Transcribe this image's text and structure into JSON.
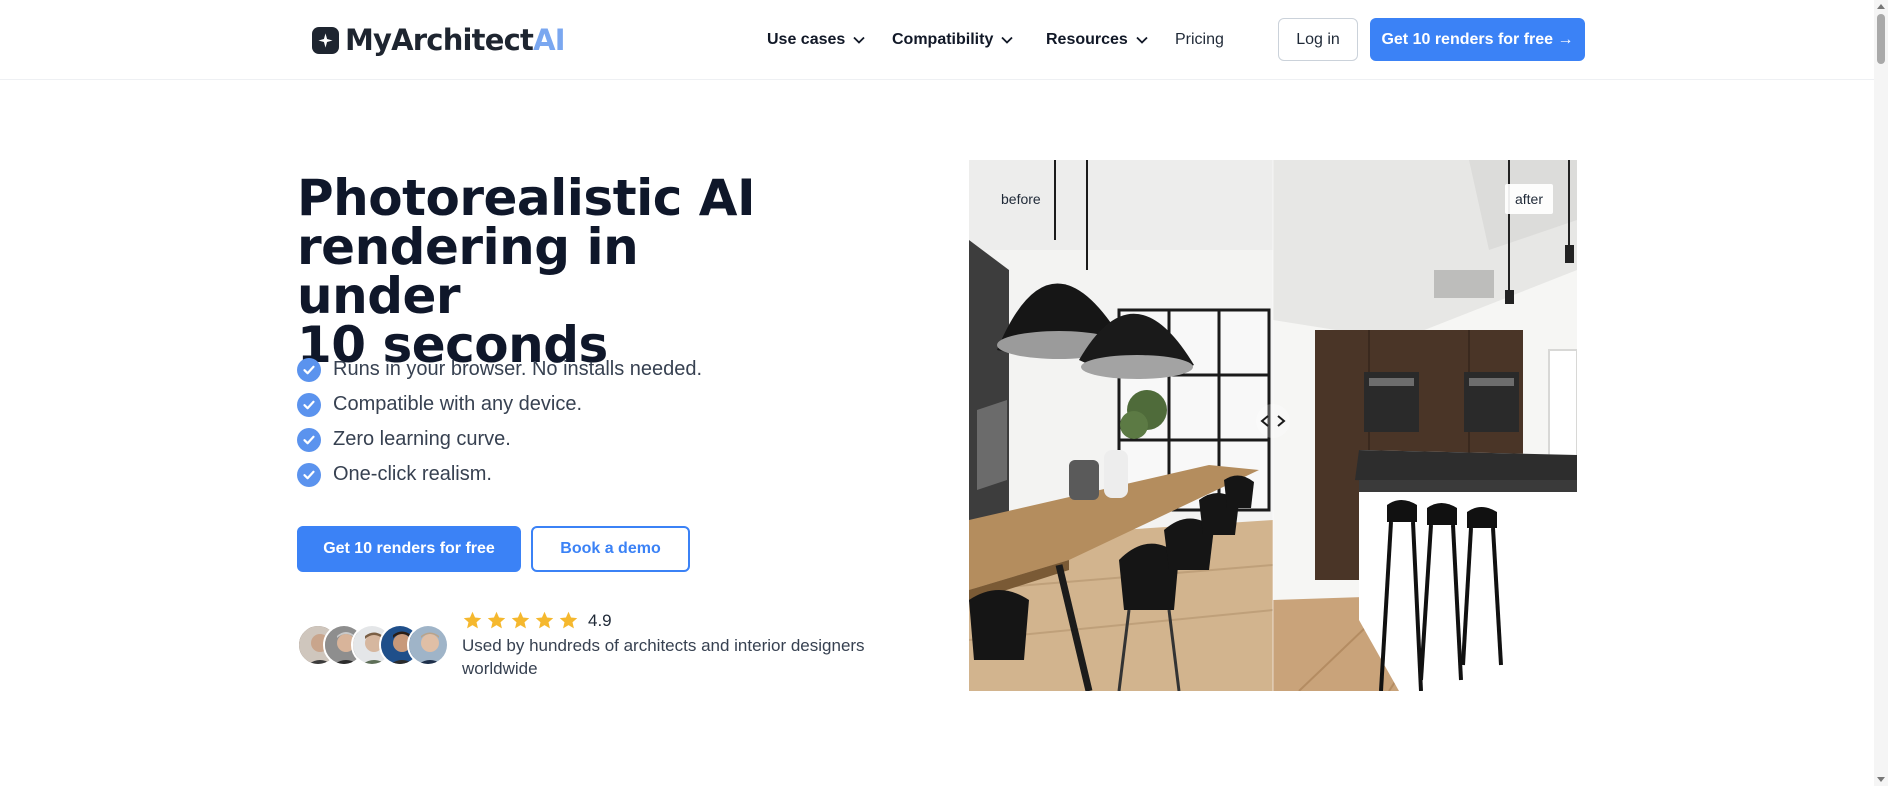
{
  "header": {
    "logo": {
      "text_main": "MyArchitect",
      "text_accent": "AI",
      "icon": "sparkle-logo-icon"
    },
    "nav": [
      {
        "label": "Use cases",
        "has_dropdown": true
      },
      {
        "label": "Compatibility",
        "has_dropdown": true
      },
      {
        "label": "Resources",
        "has_dropdown": true
      },
      {
        "label": "Pricing",
        "has_dropdown": false
      }
    ],
    "login_label": "Log in",
    "cta_label": "Get 10 renders for free →"
  },
  "hero": {
    "title_lines": [
      "Photorealistic AI",
      "rendering in under",
      "10 seconds"
    ],
    "features": [
      "Runs in your browser. No installs needed.",
      "Compatible with any device.",
      "Zero learning curve.",
      "One-click realism."
    ],
    "primary_cta": "Get 10 renders for free",
    "secondary_cta": "Book a demo",
    "rating": {
      "value": "4.9",
      "stars": 5
    },
    "social_proof": "Used by hundreds of architects and interior designers worldwide"
  },
  "compare": {
    "before_label": "before",
    "after_label": "after",
    "handle_icon": "compare-arrows-icon"
  },
  "colors": {
    "accent": "#3b82f6",
    "check": "#5b93ee",
    "star": "#f5b82e",
    "title": "#0f172a"
  }
}
